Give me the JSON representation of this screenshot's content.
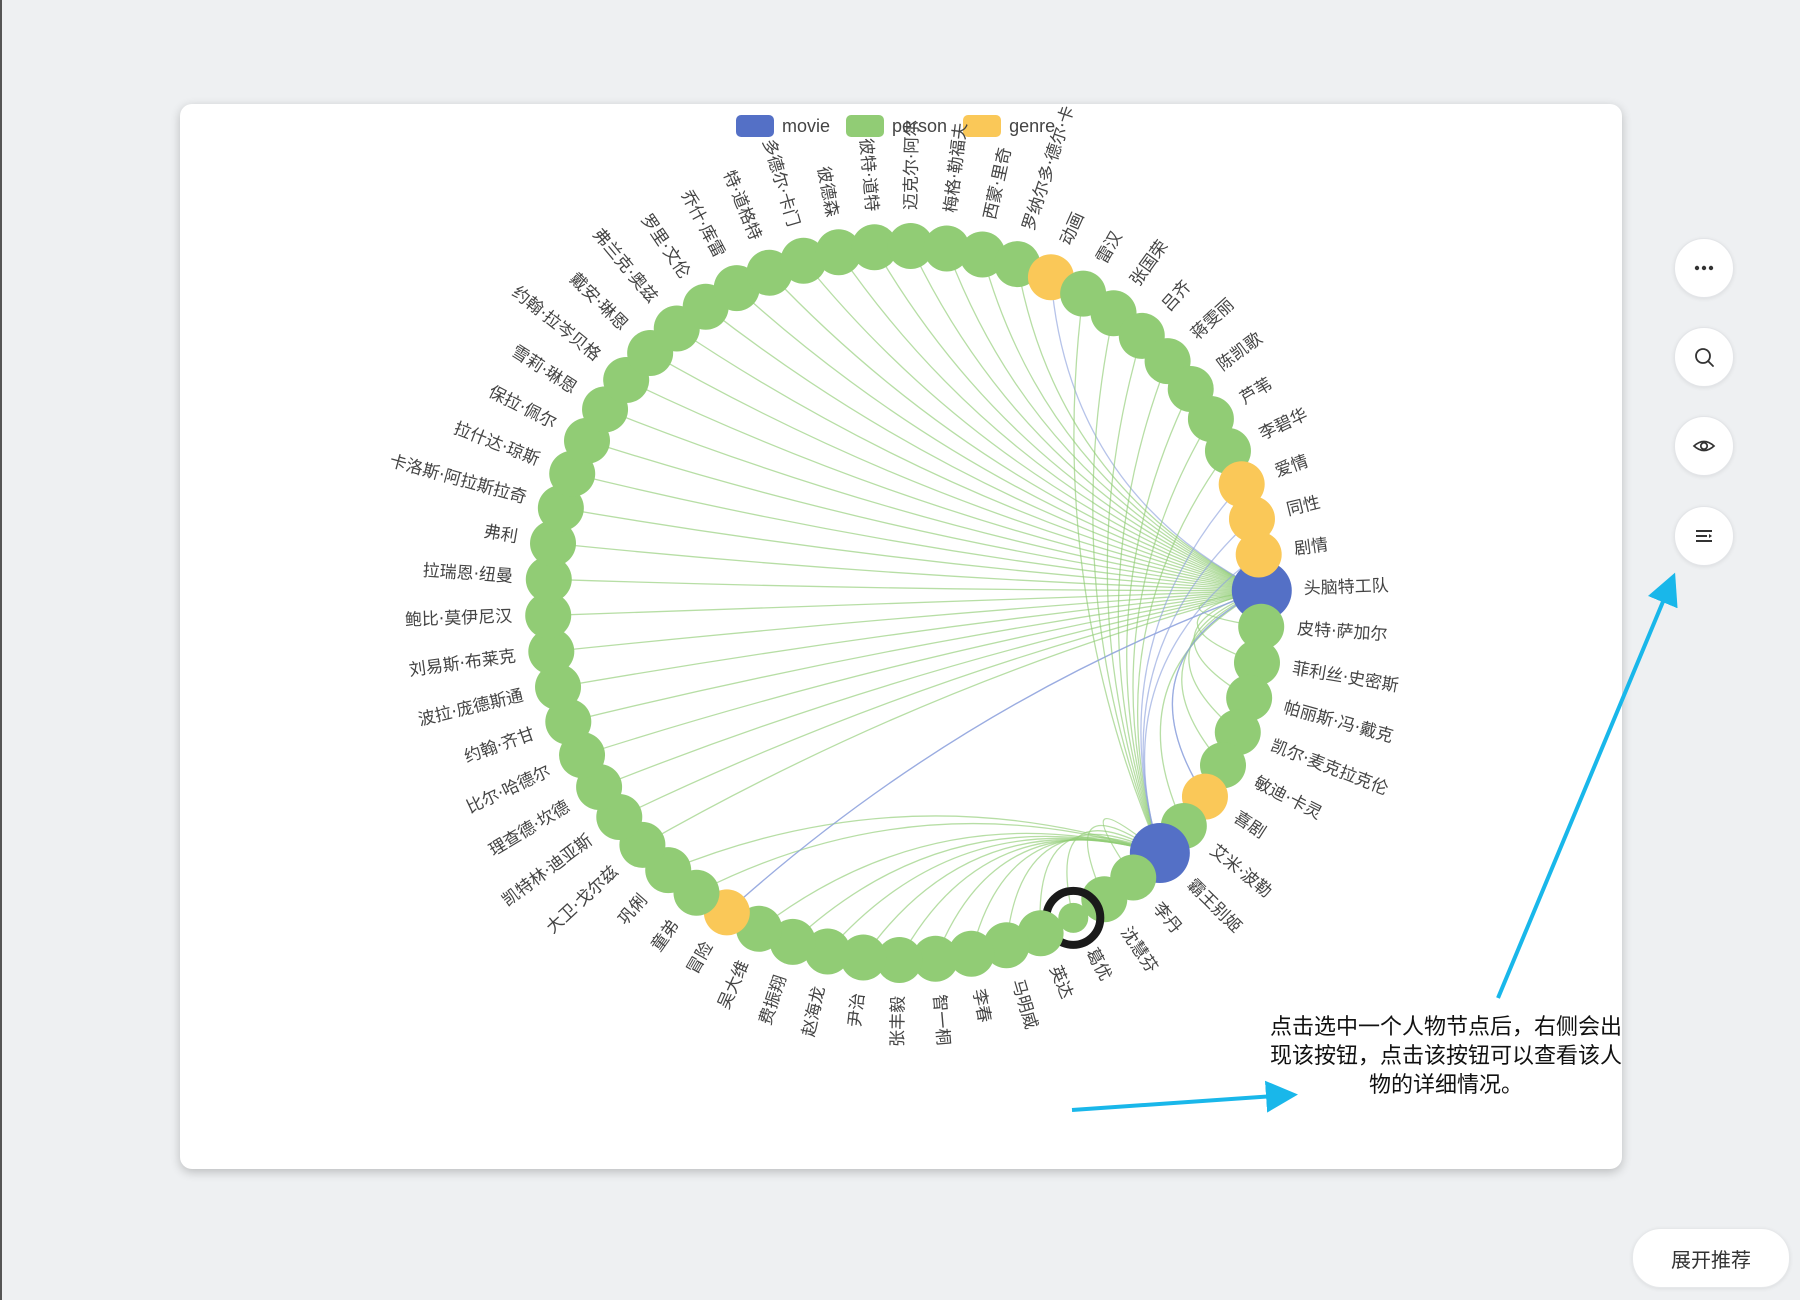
{
  "legend": [
    {
      "name": "movie",
      "color": "#5470c6"
    },
    {
      "name": "person",
      "color": "#91cc75"
    },
    {
      "name": "genre",
      "color": "#fac858"
    }
  ],
  "colors": {
    "movie": "#5470c6",
    "person": "#91cc75",
    "genre": "#fac858",
    "selected_ring": "#1a1a1a"
  },
  "graph": {
    "selected_node": "葛优",
    "nodes": [
      {
        "name": "头脑特工队",
        "category": "movie"
      },
      {
        "name": "皮特·萨加尔",
        "category": "person"
      },
      {
        "name": "菲利丝·史密斯",
        "category": "person"
      },
      {
        "name": "帕丽斯·冯·戴克",
        "category": "person"
      },
      {
        "name": "凯尔·麦克拉克伦",
        "category": "person"
      },
      {
        "name": "敏迪·卡灵",
        "category": "person"
      },
      {
        "name": "喜剧",
        "category": "genre"
      },
      {
        "name": "艾米·波勒",
        "category": "person"
      },
      {
        "name": "霸王别姬",
        "category": "movie"
      },
      {
        "name": "李丹",
        "category": "person"
      },
      {
        "name": "沈慧芬",
        "category": "person"
      },
      {
        "name": "葛优",
        "category": "person"
      },
      {
        "name": "英达",
        "category": "person"
      },
      {
        "name": "马明威",
        "category": "person"
      },
      {
        "name": "李春",
        "category": "person"
      },
      {
        "name": "智一桐",
        "category": "person"
      },
      {
        "name": "张丰毅",
        "category": "person"
      },
      {
        "name": "尹治",
        "category": "person"
      },
      {
        "name": "赵海龙",
        "category": "person"
      },
      {
        "name": "费振翔",
        "category": "person"
      },
      {
        "name": "吴大维",
        "category": "person"
      },
      {
        "name": "冒险",
        "category": "genre"
      },
      {
        "name": "童弟",
        "category": "person"
      },
      {
        "name": "巩俐",
        "category": "person"
      },
      {
        "name": "大卫·戈尔兹",
        "category": "person"
      },
      {
        "name": "凯特林·迪亚斯",
        "category": "person"
      },
      {
        "name": "理查德·坎德",
        "category": "person"
      },
      {
        "name": "比尔·哈德尔",
        "category": "person"
      },
      {
        "name": "约翰·齐甘",
        "category": "person"
      },
      {
        "name": "波拉·庞德斯通",
        "category": "person"
      },
      {
        "name": "刘易斯·布莱克",
        "category": "person"
      },
      {
        "name": "鲍比·莫伊尼汉",
        "category": "person"
      },
      {
        "name": "拉瑞恩·纽曼",
        "category": "person"
      },
      {
        "name": "弗利",
        "category": "person"
      },
      {
        "name": "卡洛斯·阿拉斯拉奇",
        "category": "person"
      },
      {
        "name": "拉什达·琼斯",
        "category": "person"
      },
      {
        "name": "保拉·佩尔",
        "category": "person"
      },
      {
        "name": "雪莉·琳恩",
        "category": "person"
      },
      {
        "name": "约翰·拉岑贝格",
        "category": "person"
      },
      {
        "name": "戴安·琳恩",
        "category": "person"
      },
      {
        "name": "弗兰克·奥兹",
        "category": "person"
      },
      {
        "name": "罗里·文伦",
        "category": "person"
      },
      {
        "name": "乔什·库雷",
        "category": "person"
      },
      {
        "name": "特·道格特",
        "category": "person"
      },
      {
        "name": "多德尔·卡门",
        "category": "person"
      },
      {
        "name": "彼德森",
        "category": "person"
      },
      {
        "name": "彼特·道特",
        "category": "person"
      },
      {
        "name": "迈克尔·阿尔",
        "category": "person"
      },
      {
        "name": "梅格·勒福夫",
        "category": "person"
      },
      {
        "name": "西蒙·里奇",
        "category": "person"
      },
      {
        "name": "罗纳尔多·德尔·卡",
        "category": "person"
      },
      {
        "name": "动画",
        "category": "genre"
      },
      {
        "name": "雷汉",
        "category": "person"
      },
      {
        "name": "张国荣",
        "category": "person"
      },
      {
        "name": "吕齐",
        "category": "person"
      },
      {
        "name": "蒋雯丽",
        "category": "person"
      },
      {
        "name": "陈凯歌",
        "category": "person"
      },
      {
        "name": "芦苇",
        "category": "person"
      },
      {
        "name": "李碧华",
        "category": "person"
      },
      {
        "name": "爱情",
        "category": "genre"
      },
      {
        "name": "同性",
        "category": "genre"
      },
      {
        "name": "剧情",
        "category": "genre"
      }
    ]
  },
  "side_buttons": [
    {
      "name": "more-icon"
    },
    {
      "name": "search-icon"
    },
    {
      "name": "eye-icon"
    },
    {
      "name": "detail-list-icon"
    }
  ],
  "expand_label": "展开推荐",
  "annotation_text": "点击选中一个人物节点后，右侧会出现该按钮，点击该按钮可以查看该人物的详细情况。"
}
